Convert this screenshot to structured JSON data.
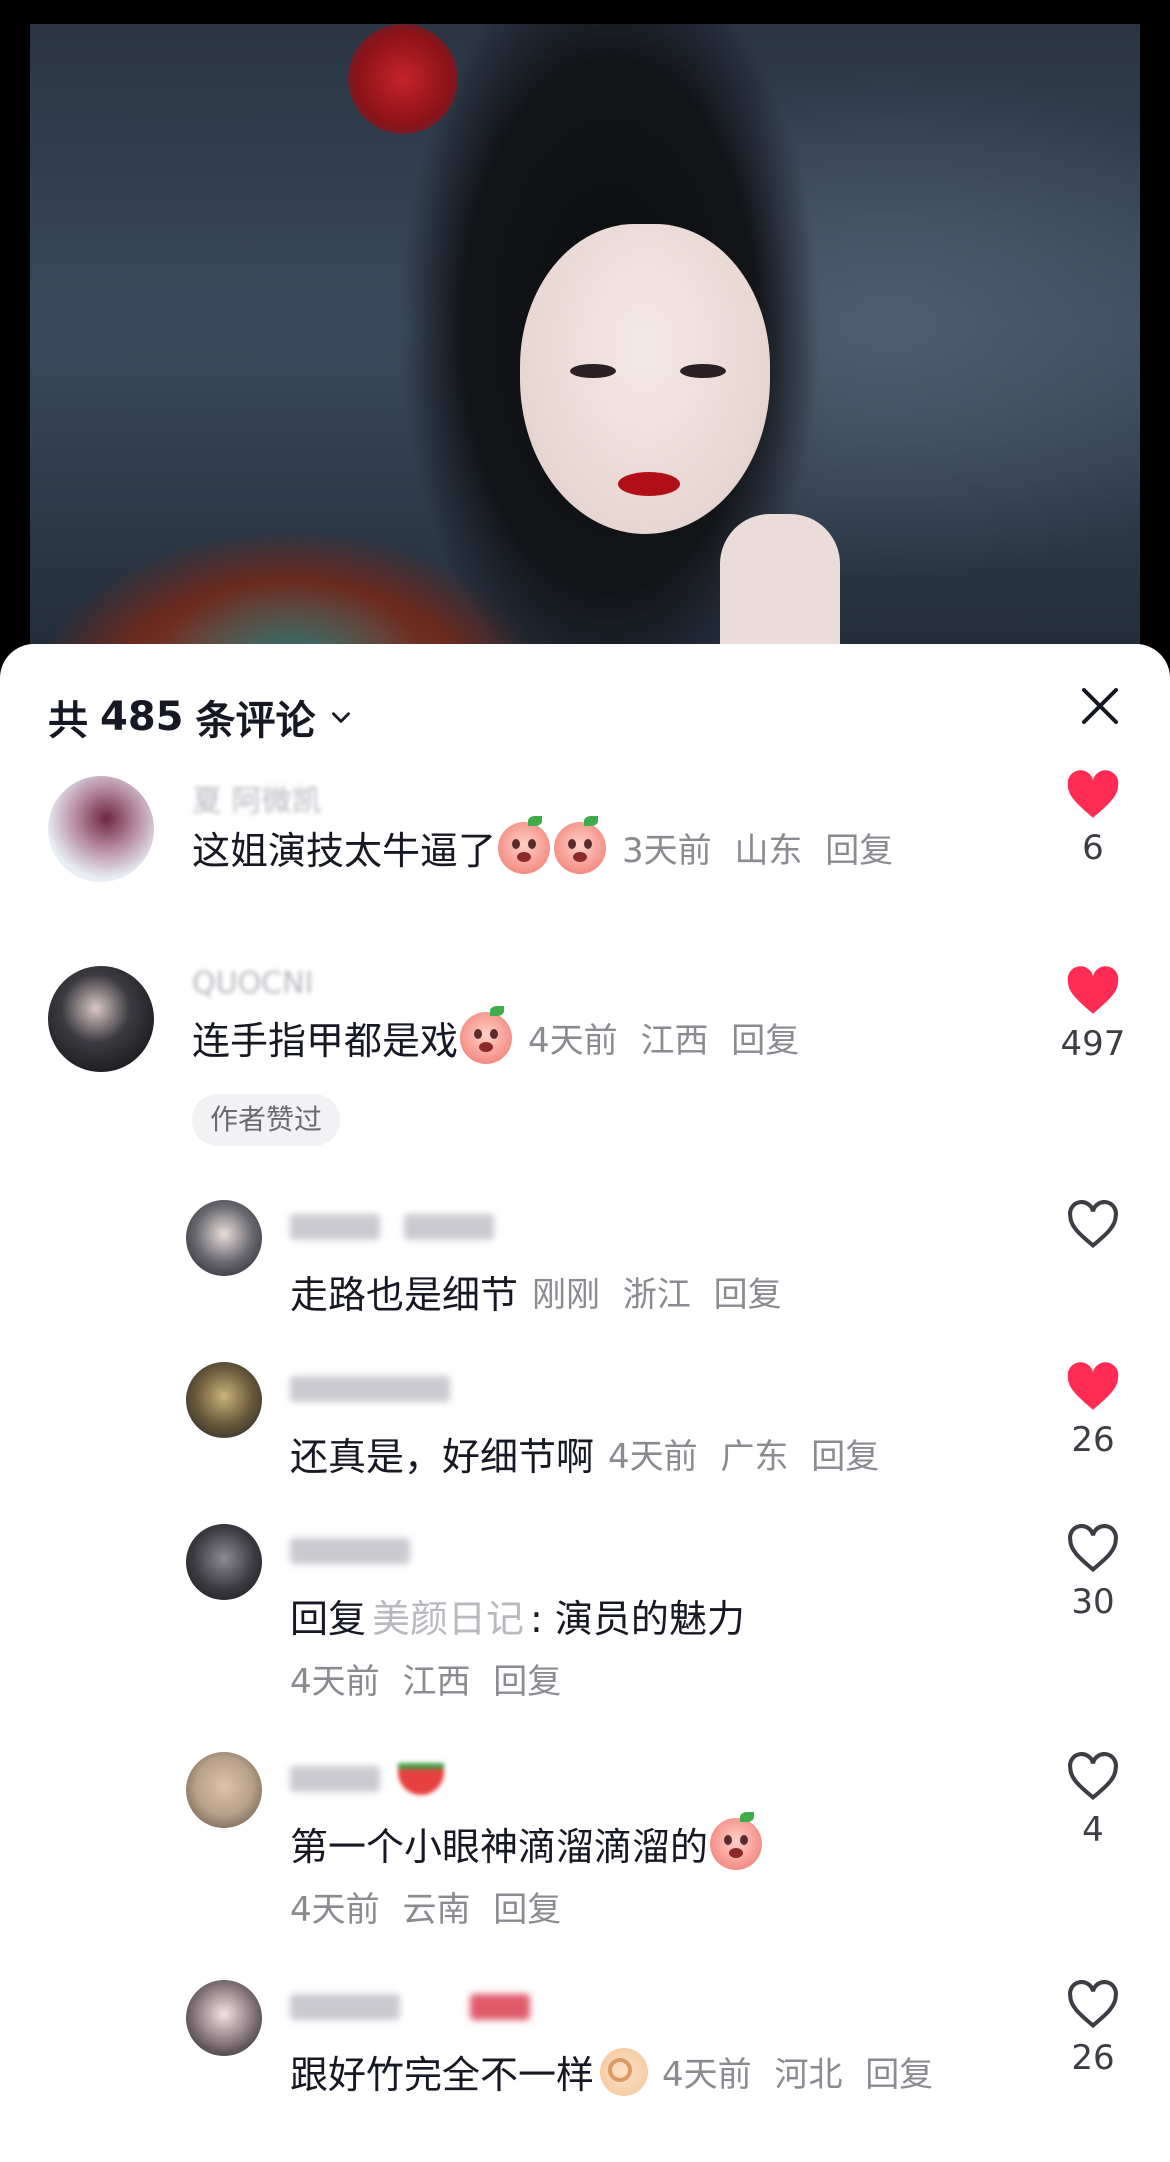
{
  "header": {
    "prefix": "共",
    "count": "485",
    "suffix": "条评论"
  },
  "icons": {
    "dropdown": "chevron-down-icon",
    "close": "close-icon",
    "like_filled": "heart-filled-icon",
    "like_empty": "heart-outline-icon"
  },
  "colors": {
    "accent_red": "#fe2c55",
    "text_primary": "#161823",
    "text_secondary": "#8a8b91"
  },
  "comments": [
    {
      "username": "夏 阿微凯",
      "text": "这姐演技太牛逼了",
      "time": "3天前",
      "location": "山东",
      "reply": "回复",
      "likes": "6",
      "liked": true
    },
    {
      "username": "QUOCNI",
      "text": "连手指甲都是戏",
      "time": "4天前",
      "location": "江西",
      "reply": "回复",
      "likes": "497",
      "liked": true,
      "badge": "作者赞过",
      "replies": [
        {
          "username": "",
          "text": "走路也是细节",
          "time": "刚刚",
          "location": "浙江",
          "reply": "回复",
          "likes": "",
          "liked": false
        },
        {
          "username": "",
          "text": "还真是，好细节啊",
          "time": "4天前",
          "location": "广东",
          "reply": "回复",
          "likes": "26",
          "liked": true
        },
        {
          "username": "",
          "text_prefix": "回复",
          "target": "美颜日记",
          "text": ": 演员的魅力",
          "time": "4天前",
          "location": "江西",
          "reply": "回复",
          "likes": "30",
          "liked": false
        },
        {
          "username": "",
          "text": "第一个小眼神滴溜滴溜的",
          "time": "4天前",
          "location": "云南",
          "reply": "回复",
          "likes": "4",
          "liked": false
        },
        {
          "username": "",
          "text": "跟好竹完全不一样",
          "time": "4天前",
          "location": "河北",
          "reply": "回复",
          "likes": "26",
          "liked": false
        }
      ]
    }
  ]
}
